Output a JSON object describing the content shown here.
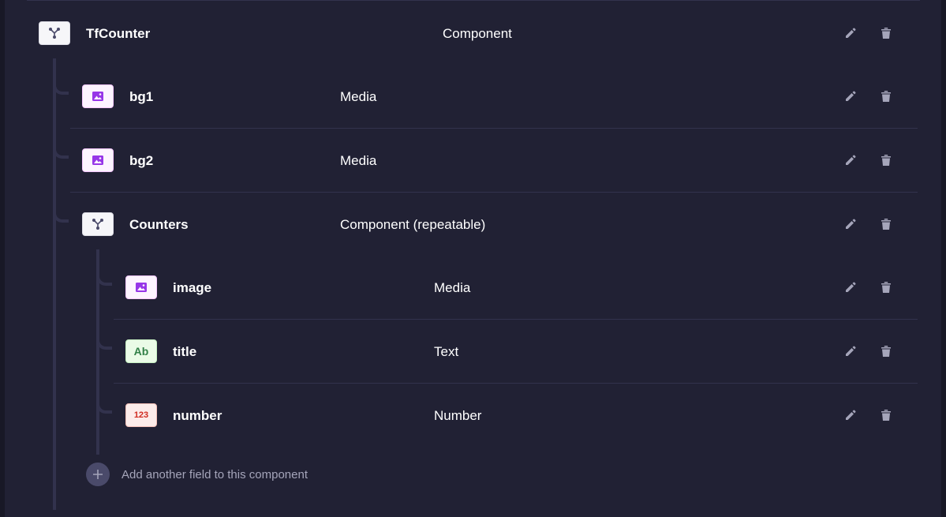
{
  "root": {
    "name": "TfCounter",
    "type": "Component",
    "icon": "component-icon"
  },
  "children": [
    {
      "name": "bg1",
      "type": "Media",
      "icon": "media-icon"
    },
    {
      "name": "bg2",
      "type": "Media",
      "icon": "media-icon"
    },
    {
      "name": "Counters",
      "type": "Component (repeatable)",
      "icon": "component-icon"
    }
  ],
  "nested": [
    {
      "name": "image",
      "type": "Media",
      "icon": "media-icon"
    },
    {
      "name": "title",
      "type": "Text",
      "icon": "text-icon",
      "glyph": "Ab"
    },
    {
      "name": "number",
      "type": "Number",
      "icon": "number-icon",
      "glyph": "123"
    }
  ],
  "add_field_label": "Add another field to this component",
  "colors": {
    "background": "#212134",
    "divider": "#32324d",
    "media_accent": "#9736e8",
    "text_accent": "#328048",
    "number_accent": "#d02b20",
    "action_icon": "#a5a5ba"
  }
}
